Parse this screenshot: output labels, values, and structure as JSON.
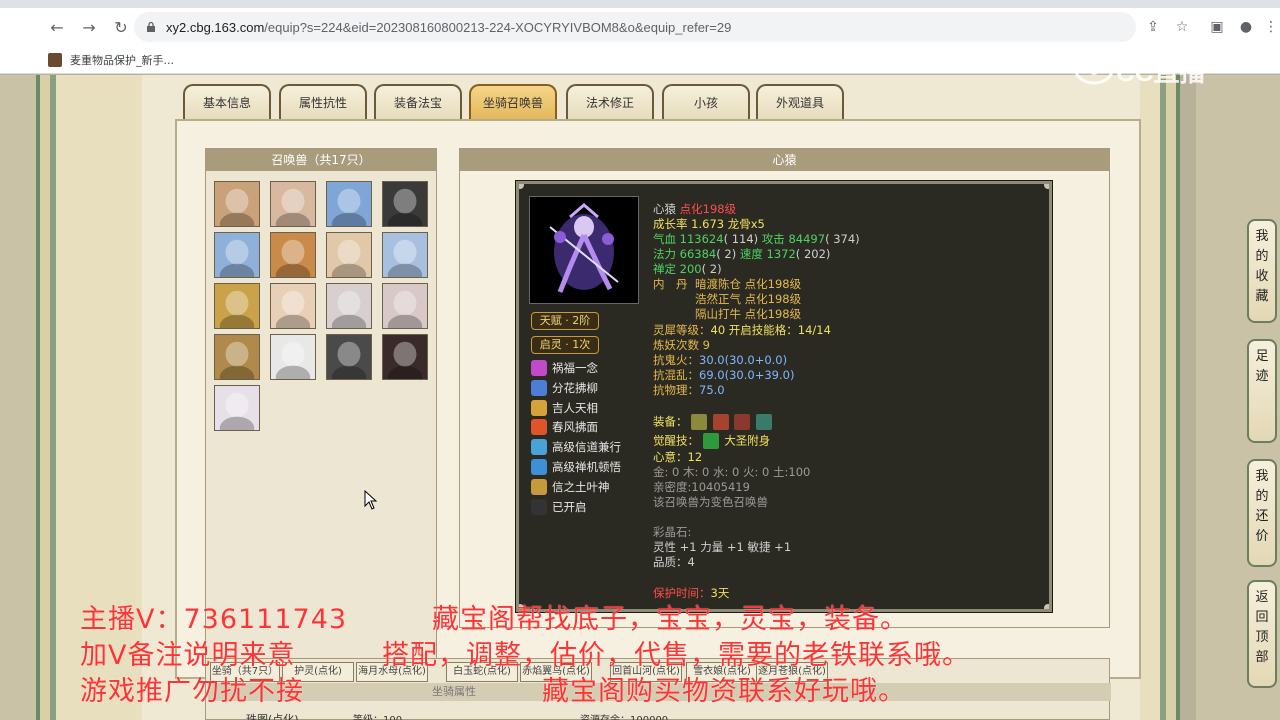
{
  "browser": {
    "url_host": "xy2.cbg.163.com",
    "url_rest": "/equip?s=224&eid=202308160800213-224-XOCYRYIVBOM8&o&equip_refer=29",
    "bookmark": "麦重物品保护_新手..."
  },
  "tabs": [
    "基本信息",
    "属性抗性",
    "装备法宝",
    "坐骑召唤兽",
    "法术修正",
    "小孩",
    "外观道具"
  ],
  "active_tab": "坐骑召唤兽",
  "summon_list": {
    "title": "召唤兽（共17只）",
    "count": 17
  },
  "detail": {
    "title": "心猿",
    "badges": [
      "天赋 · 2阶",
      "启灵 · 1次"
    ],
    "skills": [
      {
        "name": "祸福一念",
        "color": "#c04ac7"
      },
      {
        "name": "分花拂柳",
        "color": "#4d7dd6"
      },
      {
        "name": "吉人天相",
        "color": "#d6a33a"
      },
      {
        "name": "春风拂面",
        "color": "#e0542a"
      },
      {
        "name": "高级信道兼行",
        "color": "#4aa3d6"
      },
      {
        "name": "高级禅机顿悟",
        "color": "#3d8fd6"
      },
      {
        "name": "信之土叶神",
        "color": "#c49a3a"
      },
      {
        "name": "已开启",
        "color": "#333333"
      }
    ],
    "name": "心猿",
    "name_tag": "点化198级",
    "growth": "成长率 1.673 龙骨x5",
    "hp_label": "气血",
    "hp": "113624",
    "hp_extra": "( 114)",
    "atk_label": "攻击",
    "atk": "84497",
    "atk_extra": "( 374)",
    "mp_label": "法力",
    "mp": "66384",
    "mp_extra": "( 2)",
    "spd_label": "速度",
    "spd": "1372",
    "spd_extra": "( 202)",
    "zen_label": "禅定",
    "zen": "200",
    "zen_extra": "( 2)",
    "neidan_label": "内　丹",
    "neidan": [
      "暗渡陈仓 点化198级",
      "浩然正气 点化198级",
      "隔山打牛 点化198级"
    ],
    "lingxi_label": "灵犀等级：",
    "lingxi": "40",
    "lingxi_skill_label": "开启技能格：",
    "lingxi_skill": "14/14",
    "lianyao": "炼妖次数 9",
    "resist1_label": "抗鬼火：",
    "resist1": "30.0(30.0+0.0)",
    "resist2_label": "抗混乱：",
    "resist2": "69.0(30.0+39.0)",
    "resist3_label": "抗物理：",
    "resist3": "75.0",
    "equip_label": "装备：",
    "awaken_label": "觉醒技：",
    "awaken": "大圣附身",
    "xinyi_label": "心意：",
    "xinyi": "12",
    "elements": "金: 0 木: 0 水: 0 火: 0 土:100",
    "intimacy": "亲密度:10405419",
    "note": "该召唤兽为变色召唤兽",
    "crystal_label": "彩晶石:",
    "crystal": "灵性 +1 力量 +1 敏捷 +1",
    "quality": "品质：4",
    "protect_label": "保护时间：",
    "protect": "3天"
  },
  "side_buttons": [
    "我的收藏",
    "足迹",
    "我的还价",
    "返回顶部"
  ],
  "subtabs": [
    "坐骑（共7只）",
    "护灵(点化)",
    "海月水母(点化)",
    "白玉蛇(点化)",
    "赤焰翼鸟(点化)",
    "回首山河(点化)",
    "雪衣娘(点化)",
    "逐月苍狼(点化)"
  ],
  "sub_header": "坐骑属性",
  "bottom_row": {
    "a": "珠图(点化)",
    "b": "等级：100",
    "c": "资源存余：100000"
  },
  "overlay": {
    "line1a": "主播V：736111743",
    "line1b": "藏宝阁帮找底子，宝宝，灵宝，装备。",
    "line2a": "加V备注说明来意",
    "line2b": "搭配，调整，估价，代售，需要的老铁联系哦。",
    "line3a": "游戏推广勿扰不接",
    "line3b": "藏宝阁购买物资联系好玩哦。",
    "logo": "CC直播"
  },
  "colors": {
    "accent": "#e4b75a",
    "watermark": "#ff2828",
    "card_bg": "#2b2a22"
  }
}
